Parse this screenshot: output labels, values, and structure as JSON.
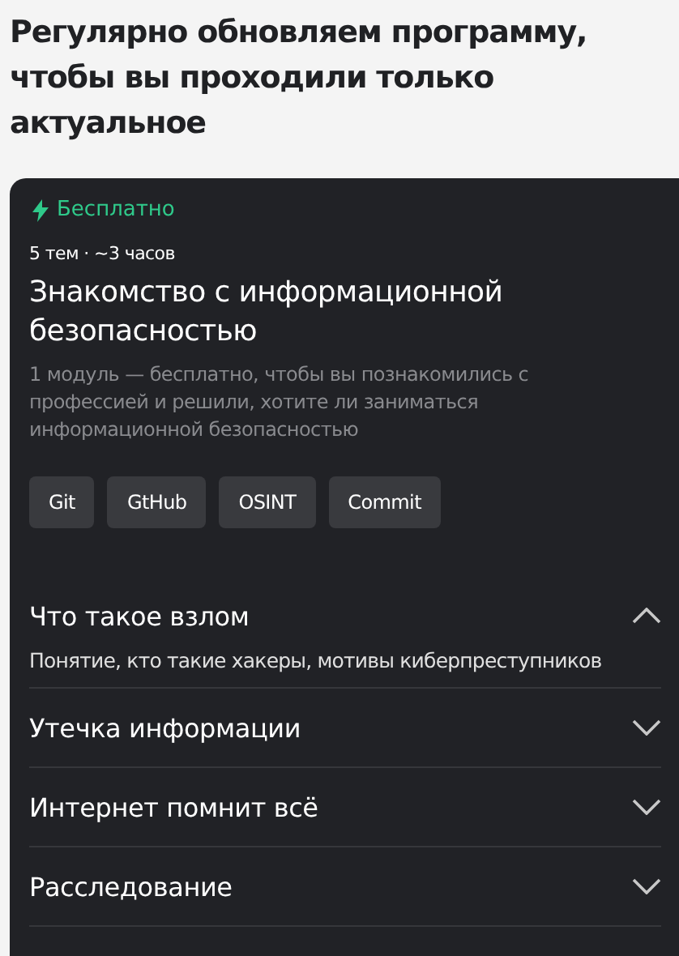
{
  "heading": "Регулярно обновляем программу, чтобы вы проходили только актуальное",
  "card": {
    "badge": "Бесплатно",
    "meta": "5 тем · ~3 часов",
    "title": "Знакомство с информационной безопасностью",
    "description": "1 модуль — бесплатно, чтобы вы познакомились с профессией и решили, хотите ли заниматься информационной безопасностью",
    "tags": [
      "Git",
      "GtHub",
      "OSINT",
      "Commit"
    ],
    "topics": [
      {
        "title": "Что такое взлом",
        "expanded": true,
        "details": "Понятие, кто такие хакеры, мотивы киберпреступников"
      },
      {
        "title": "Утечка информации",
        "expanded": false
      },
      {
        "title": "Интернет помнит всё",
        "expanded": false
      },
      {
        "title": "Расследование",
        "expanded": false
      }
    ]
  }
}
